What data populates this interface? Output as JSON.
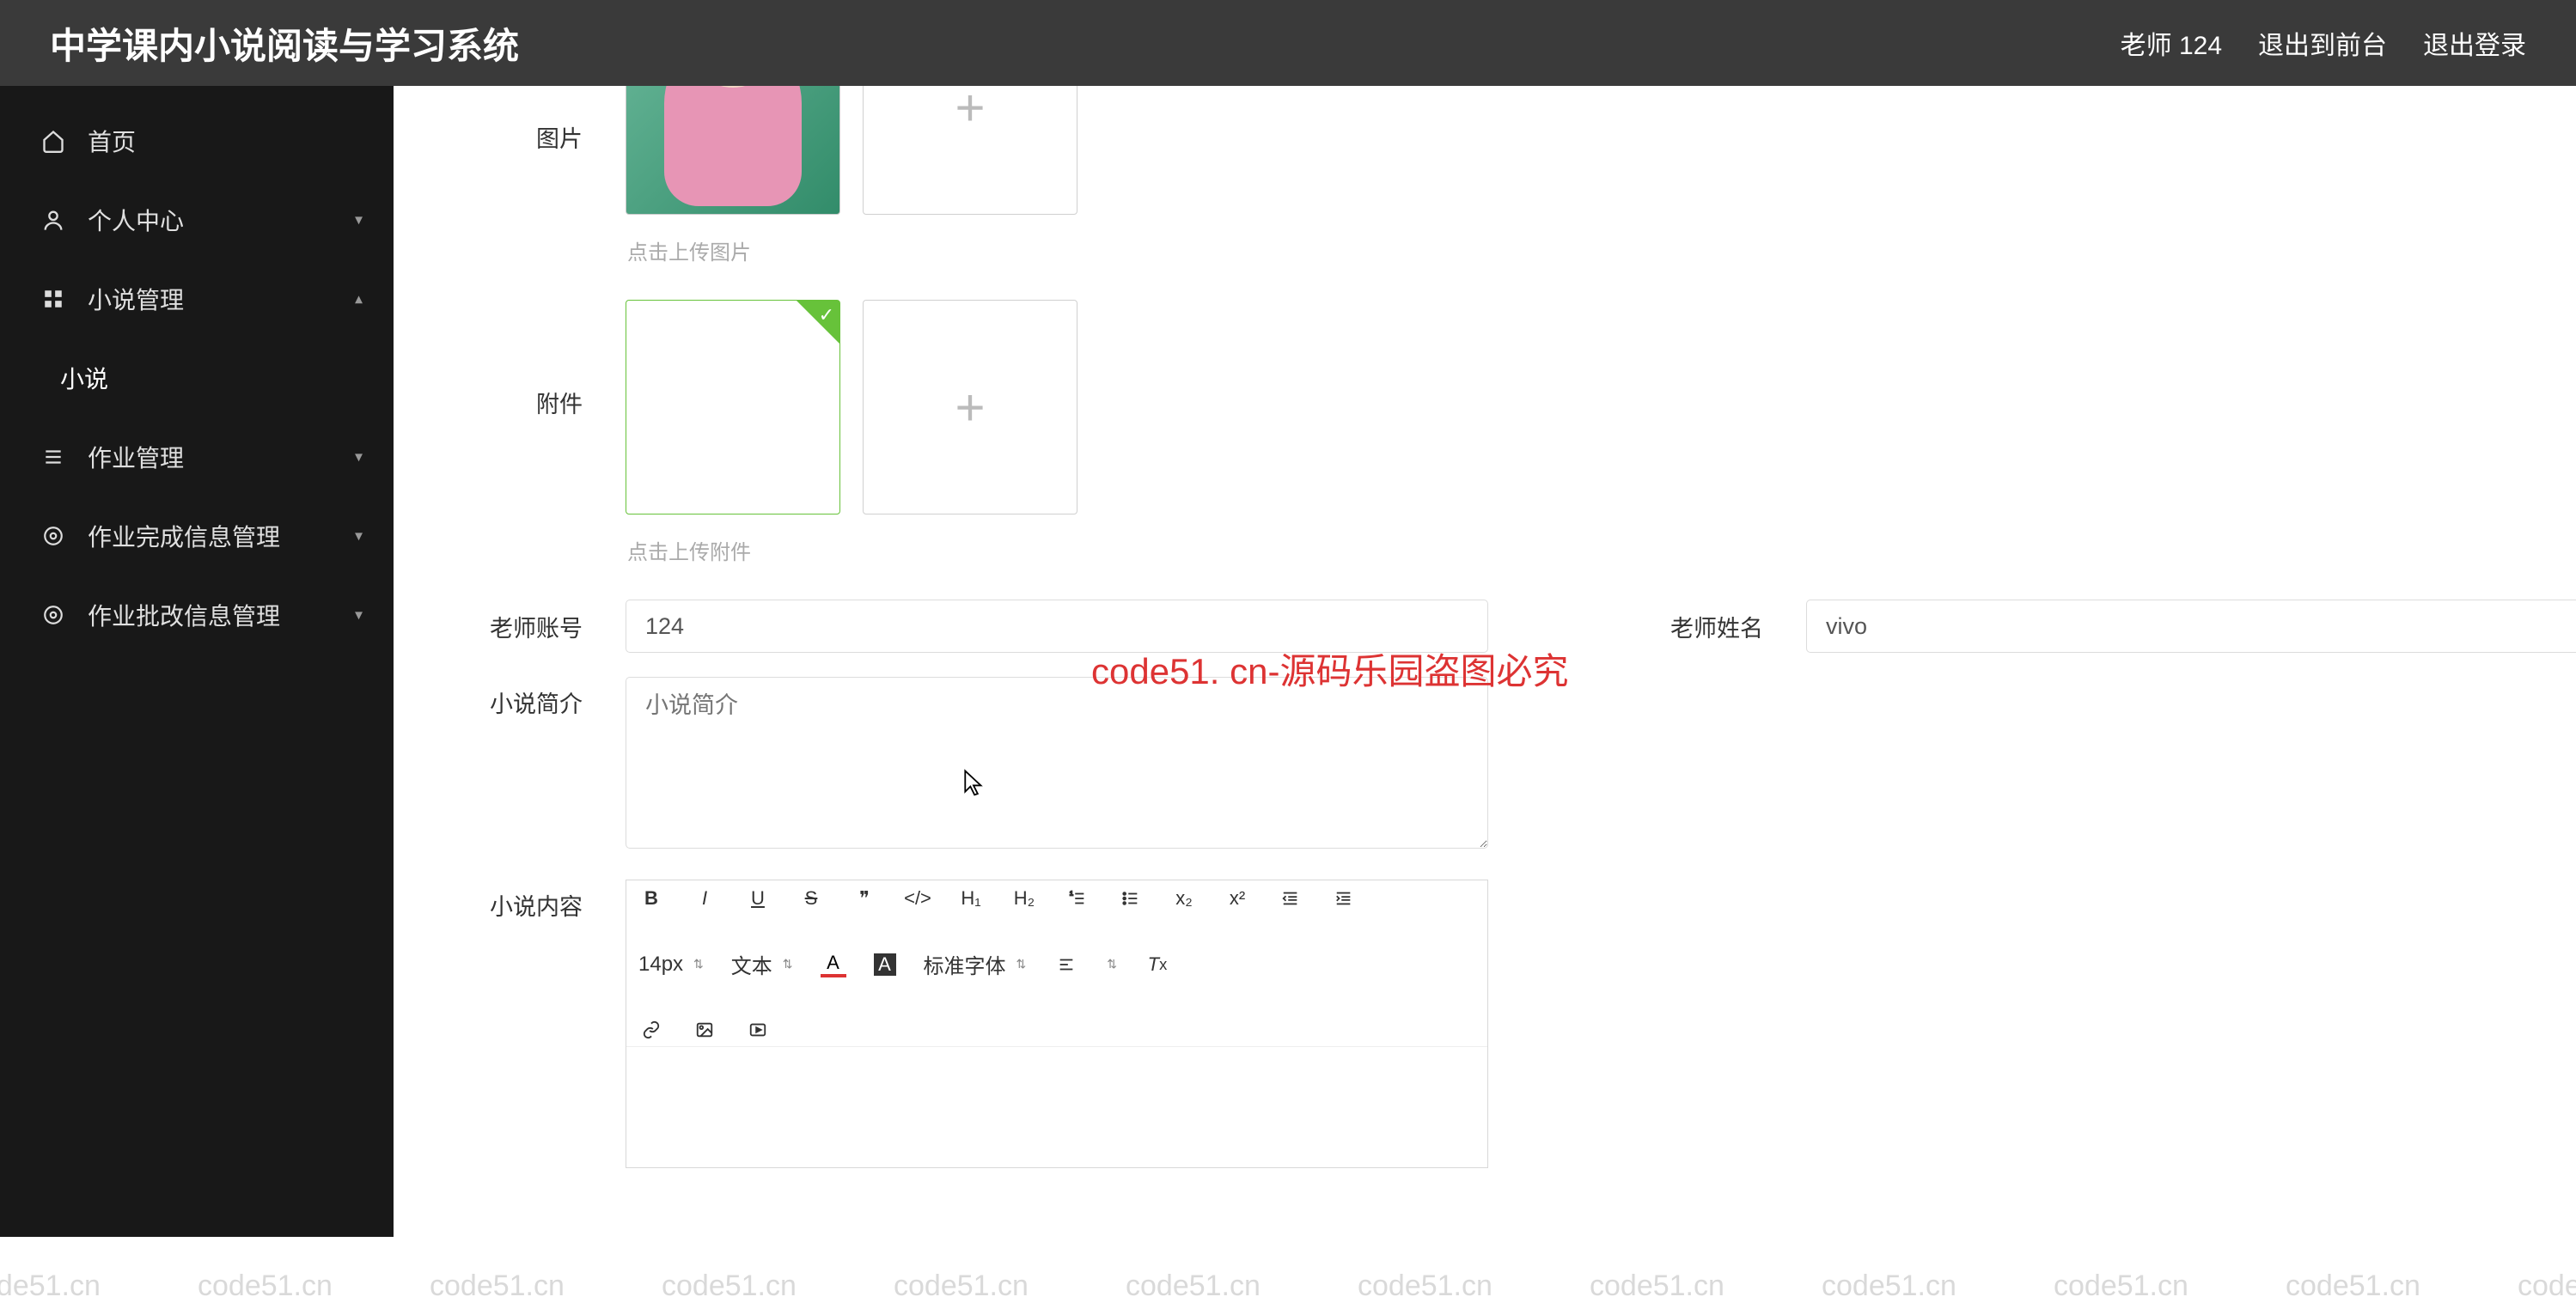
{
  "header": {
    "title": "中学课内小说阅读与学习系统",
    "user": "老师 124",
    "logout_front": "退出到前台",
    "logout": "退出登录"
  },
  "sidebar": {
    "home": "首页",
    "personal": "个人中心",
    "novel_mgmt": "小说管理",
    "novel": "小说",
    "homework_mgmt": "作业管理",
    "homework_done_mgmt": "作业完成信息管理",
    "homework_review_mgmt": "作业批改信息管理"
  },
  "form": {
    "image_label": "图片",
    "image_hint": "点击上传图片",
    "attach_label": "附件",
    "attach_hint": "点击上传附件",
    "teacher_account_label": "老师账号",
    "teacher_account_value": "124",
    "teacher_name_label": "老师姓名",
    "teacher_name_value": "vivo",
    "intro_label": "小说简介",
    "intro_placeholder": "小说简介",
    "content_label": "小说内容"
  },
  "editor": {
    "size": "14px",
    "text_style": "文本",
    "font_family": "标准字体"
  },
  "watermark": {
    "text": "code51.cn",
    "center": "code51. cn-源码乐园盗图必究"
  }
}
